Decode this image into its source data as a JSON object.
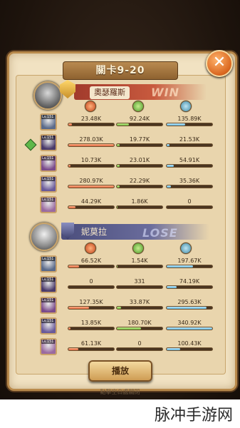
{
  "title": "關卡9-20",
  "close_icon": "close-icon",
  "winner": {
    "name": "奧瑟羅斯",
    "outcome": "WIN",
    "heroes": [
      {
        "level": "Lv.151",
        "dmg": "23.48K",
        "heal": "92.24K",
        "def": "135.89K",
        "dmg_frac": 0.08,
        "heal_frac": 0.27,
        "def_frac": 0.4
      },
      {
        "level": "Lv.151",
        "dmg": "278.03K",
        "heal": "19.77K",
        "def": "21.53K",
        "dmg_frac": 1.0,
        "heal_frac": 0.06,
        "def_frac": 0.06
      },
      {
        "level": "Lv.151",
        "dmg": "10.73K",
        "heal": "23.01K",
        "def": "54.91K",
        "dmg_frac": 0.04,
        "heal_frac": 0.07,
        "def_frac": 0.16
      },
      {
        "level": "Lv.151",
        "dmg": "280.97K",
        "heal": "22.29K",
        "def": "35.36K",
        "dmg_frac": 1.0,
        "heal_frac": 0.07,
        "def_frac": 0.1
      },
      {
        "level": "Lv.151",
        "dmg": "44.29K",
        "heal": "1.86K",
        "def": "0",
        "dmg_frac": 0.16,
        "heal_frac": 0.01,
        "def_frac": 0.0
      }
    ]
  },
  "loser": {
    "name": "妮莫拉",
    "outcome": "LOSE",
    "heroes": [
      {
        "level": "Lv.151",
        "dmg": "66.52K",
        "heal": "1.54K",
        "def": "197.67K",
        "dmg_frac": 0.24,
        "heal_frac": 0.01,
        "def_frac": 0.58
      },
      {
        "level": "Lv.151",
        "dmg": "0",
        "heal": "331",
        "def": "74.19K",
        "dmg_frac": 0.0,
        "heal_frac": 0.0,
        "def_frac": 0.22
      },
      {
        "level": "Lv.151",
        "dmg": "127.35K",
        "heal": "33.87K",
        "def": "295.63K",
        "dmg_frac": 0.45,
        "heal_frac": 0.1,
        "def_frac": 0.87
      },
      {
        "level": "Lv.151",
        "dmg": "13.85K",
        "heal": "180.70K",
        "def": "340.92K",
        "dmg_frac": 0.05,
        "heal_frac": 0.53,
        "def_frac": 1.0
      },
      {
        "level": "Lv.151",
        "dmg": "61.13K",
        "heal": "0",
        "def": "100.43K",
        "dmg_frac": 0.22,
        "heal_frac": 0.0,
        "def_frac": 0.3
      }
    ]
  },
  "stat_icons": [
    "damage-icon",
    "heal-icon",
    "defense-icon"
  ],
  "replay_label": "播放",
  "footer": "點擊空白處關閉",
  "watermark": "脉冲手游网",
  "colors": {
    "damage": "#e0633a",
    "heal": "#6eb83e",
    "defense": "#5fb4dc",
    "win_banner": "#a13a2c",
    "lose_banner": "#4b4e7c"
  }
}
